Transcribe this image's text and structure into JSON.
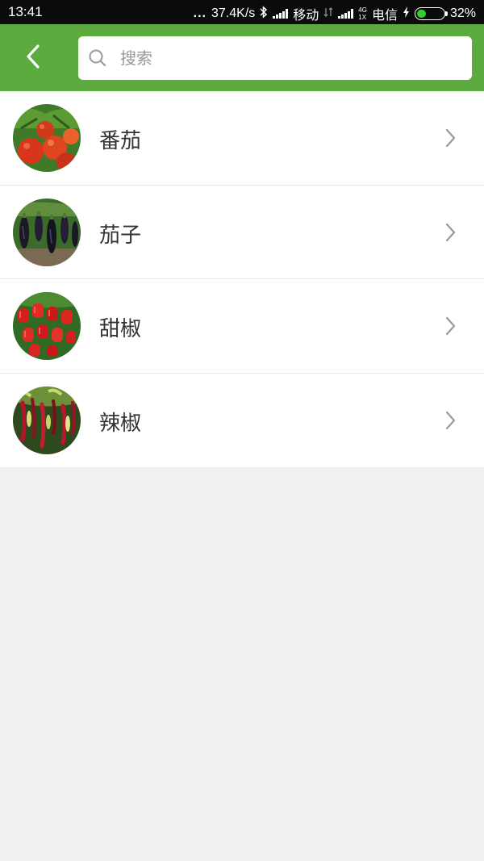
{
  "status": {
    "time": "13:41",
    "dots": "...",
    "speed": "37.4K/s",
    "carrier1": "移动",
    "carrier2": "电信",
    "net_top": "4G",
    "net_bottom": "1X",
    "battery": "32%",
    "battery_level": 0.32
  },
  "search": {
    "placeholder": "搜索",
    "value": ""
  },
  "items": [
    {
      "label": "番茄",
      "icon": "tomato-photo"
    },
    {
      "label": "茄子",
      "icon": "eggplant-photo"
    },
    {
      "label": "甜椒",
      "icon": "sweet-pepper-photo"
    },
    {
      "label": "辣椒",
      "icon": "chili-pepper-photo"
    }
  ],
  "colors": {
    "header": "#5bab3e",
    "background": "#f0f0f0"
  }
}
